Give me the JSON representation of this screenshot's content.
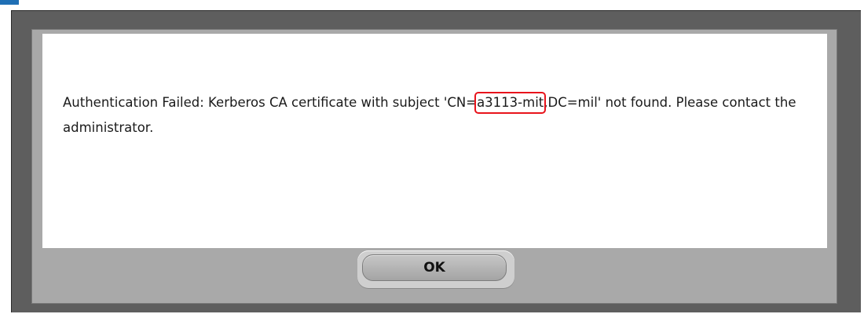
{
  "dialog": {
    "message_before": "Authentication Failed: Kerberos CA certificate with subject 'CN=",
    "message_highlight": "a3113-mit",
    "message_after": ",DC=mil' not found.  Please contact the administrator.",
    "ok_label": "OK"
  },
  "colors": {
    "frame": "#5e5e5e",
    "panel": "#a9a9a9",
    "highlight_border": "#e8141c",
    "accent": "#1f6fb5"
  }
}
